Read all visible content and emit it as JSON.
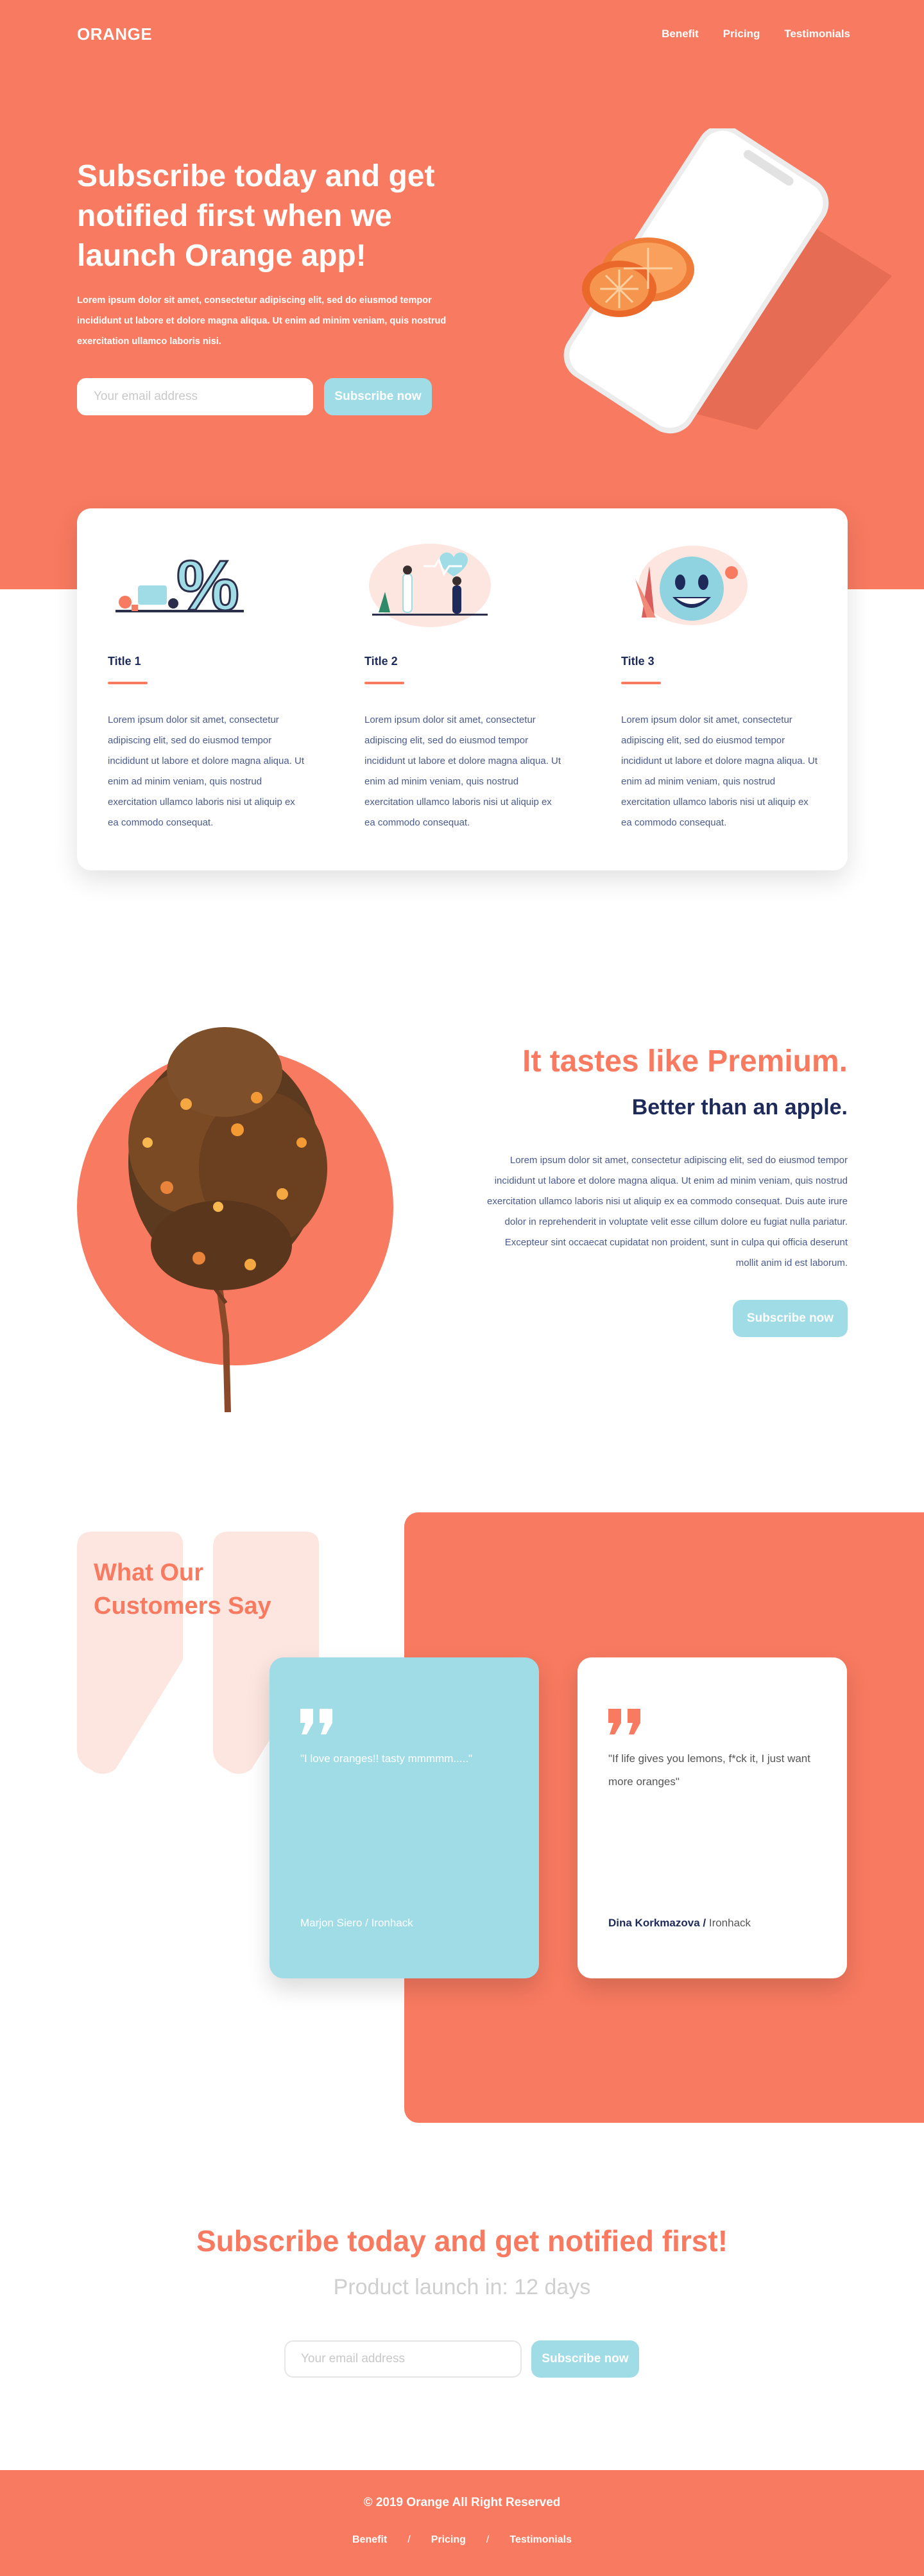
{
  "header": {
    "logo": "ORANGE",
    "nav": [
      "Benefit",
      "Pricing",
      "Testimonials"
    ]
  },
  "hero": {
    "title": "Subscribe today and get notified first when we launch Orange app!",
    "description": "Lorem ipsum dolor sit amet, consectetur adipiscing elit, sed do eiusmod tempor incididunt ut labore et dolore magna aliqua. Ut enim ad minim veniam, quis nostrud exercitation ullamco laboris nisi.",
    "email_placeholder": "Your email address",
    "button_label": "Subscribe now",
    "phone_icon": "phone-with-orange-icon"
  },
  "features": [
    {
      "icon": "discount-percent-illustration",
      "title": "Title 1",
      "text": "Lorem ipsum dolor sit amet, consectetur adipiscing elit, sed do eiusmod tempor incididunt ut labore et dolore magna aliqua. Ut enim ad minim veniam, quis nostrud exercitation ullamco laboris nisi ut aliquip ex ea commodo consequat."
    },
    {
      "icon": "health-heart-illustration",
      "title": "Title 2",
      "text": "Lorem ipsum dolor sit amet, consectetur adipiscing elit, sed do eiusmod tempor incididunt ut labore et dolore magna aliqua. Ut enim ad minim veniam, quis nostrud exercitation ullamco laboris nisi ut aliquip ex ea commodo consequat."
    },
    {
      "icon": "smiley-face-illustration",
      "title": "Title 3",
      "text": "Lorem ipsum dolor sit amet, consectetur adipiscing elit, sed do eiusmod tempor incididunt ut labore et dolore magna aliqua. Ut enim ad minim veniam, quis nostrud exercitation ullamco laboris nisi ut aliquip ex ea commodo consequat."
    }
  ],
  "premium": {
    "title": "It tastes like Premium.",
    "subtitle": "Better than an apple.",
    "text": "Lorem ipsum dolor sit amet, consectetur adipiscing elit, sed do eiusmod tempor incididunt ut labore et dolore magna aliqua. Ut enim ad minim veniam, quis nostrud exercitation ullamco laboris nisi ut aliquip ex ea commodo consequat. Duis aute irure dolor in reprehenderit in voluptate velit esse cillum dolore eu fugiat nulla pariatur. Excepteur sint occaecat cupidatat non proident, sunt in culpa qui officia deserunt mollit anim id est laborum.",
    "button_label": "Subscribe now",
    "image_icon": "orange-tree-icon"
  },
  "testimonials": {
    "title": "What Our Customers Say",
    "items": [
      {
        "quote": "\"I love oranges!! tasty mmmmm.....\"",
        "author": "Marjon Siero /",
        "org": "Ironhack"
      },
      {
        "quote": "\"If life gives you lemons, f*ck it, I just want more oranges\"",
        "author": "Dina Korkmazova /",
        "org": "Ironhack"
      }
    ]
  },
  "subscribe": {
    "title": "Subscribe today and get notified first!",
    "countdown": "Product launch in: 12 days",
    "email_placeholder": "Your email address",
    "button_label": "Subscribe now"
  },
  "footer": {
    "copyright": "© 2019 Orange All Right Reserved",
    "links": [
      "Benefit",
      "Pricing",
      "Testimonials"
    ],
    "separator": "/"
  },
  "colors": {
    "primary": "#f87a60",
    "accent": "#9fdce6",
    "navy": "#1e2a5a",
    "body_text": "#4a5a8e",
    "muted": "#cfcfcf"
  }
}
